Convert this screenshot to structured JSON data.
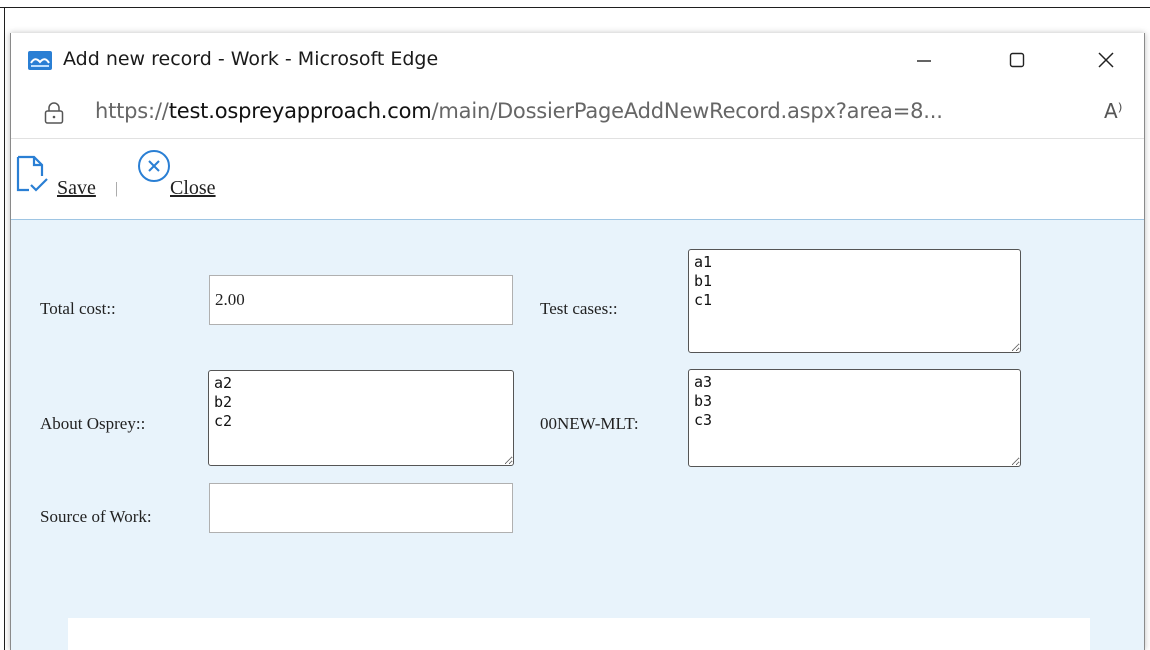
{
  "window": {
    "title": "Add new record - Work - Microsoft Edge",
    "minimize_label": "—",
    "maximize_label": "▢",
    "close_label": "✕"
  },
  "addressbar": {
    "url_scheme": "https://",
    "url_host": "test.ospreyapproach.com",
    "url_path": "/main/DossierPageAddNewRecord.aspx?area=8...",
    "read_aloud": "A⁾"
  },
  "toolbar": {
    "save_label": "Save",
    "separator": "|",
    "close_label": "Close"
  },
  "form": {
    "total_cost_label": "Total cost::",
    "total_cost_value": "2.00",
    "test_cases_label": "Test cases::",
    "test_cases_value": "a1\nb1\nc1",
    "about_osprey_label": "About Osprey::",
    "about_osprey_value": "a2\nb2\nc2",
    "new_mlt_label": "00NEW-MLT:",
    "new_mlt_value": "a3\nb3\nc3",
    "source_of_work_label": "Source of Work:",
    "source_of_work_value": ""
  },
  "colors": {
    "form_background": "#e8f3fb",
    "toolbar_border": "#9ec5e3",
    "app_icon": "#2a7fd4"
  }
}
